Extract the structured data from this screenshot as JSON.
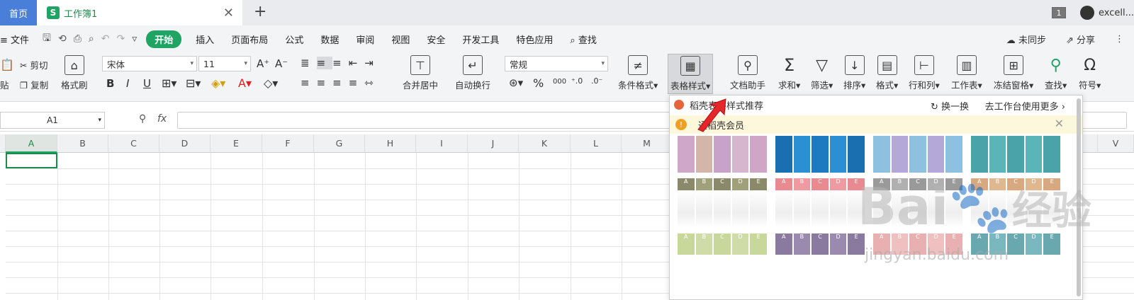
{
  "titlebar": {
    "home_tab": "首页",
    "workbook_tab": "工作簿1",
    "workbook_icon_letter": "S",
    "window_count": "1",
    "user_name": "excell..."
  },
  "menubar": {
    "file": "文件",
    "items": [
      "开始",
      "插入",
      "页面布局",
      "公式",
      "数据",
      "审阅",
      "视图",
      "安全",
      "开发工具",
      "特色应用"
    ],
    "search": "查找",
    "sync": "未同步",
    "share": "分享"
  },
  "ribbon": {
    "paste_fragment": "贴",
    "cut": "剪切",
    "copy": "复制",
    "format_painter": "格式刷",
    "font_name": "宋体",
    "font_size": "11",
    "number_format": "常规",
    "merge_center": "合并居中",
    "wrap_text": "自动换行",
    "percent": "%",
    "thousands": "000",
    "cond_format": "条件格式",
    "table_style": "表格样式",
    "doc_assistant": "文档助手",
    "sum": "求和",
    "filter": "筛选",
    "sort": "排序",
    "format": "格式",
    "rowcol": "行和列",
    "worksheet": "工作表",
    "freeze": "冻结窗格",
    "find": "查找",
    "symbol": "符号"
  },
  "formula_bar": {
    "cell_ref": "A1",
    "fx_label": "fx"
  },
  "grid": {
    "columns": [
      "A",
      "B",
      "C",
      "D",
      "E",
      "F",
      "G",
      "H",
      "I",
      "J",
      "K",
      "L",
      "M",
      "V"
    ]
  },
  "dropdown": {
    "header": "稻壳表格样式推荐",
    "refresh": "换一换",
    "workbench_more": "去工作台使用更多",
    "vip_notice": "通稻壳会员",
    "thumbnails": [
      {
        "colors": [
          "#cfa8c9",
          "#d3b6a9",
          "#c8a2c8",
          "#d6b5ce",
          "#cfa6c6"
        ]
      },
      {
        "colors": [
          "#1a6fb0",
          "#2b8fd3",
          "#1d7ac0",
          "#2b8fd3",
          "#1a6fb0"
        ]
      },
      {
        "colors": [
          "#8ec0e0",
          "#b4a8d8",
          "#8ec0e0",
          "#b4a8d8",
          "#8ec0e0"
        ]
      },
      {
        "colors": [
          "#4aa3a8",
          "#5ab5b8",
          "#4aa3a8",
          "#5ab5b8",
          "#4aa3a8"
        ]
      },
      {
        "colors": [
          "#8a8a6a",
          "#a0a07a",
          "#8a8a6a",
          "#a0a07a",
          "#8a8a6a"
        ]
      },
      {
        "colors": [
          "#e88a90",
          "#ee9aa0",
          "#e88a90",
          "#ee9aa0",
          "#e88a90"
        ]
      },
      {
        "colors": [
          "#9a9a9a",
          "#b0b0b0",
          "#9a9a9a",
          "#b0b0b0",
          "#9a9a9a"
        ]
      },
      {
        "colors": [
          "#d8a880",
          "#e0b890",
          "#d8a880",
          "#e0b890",
          "#d8a880"
        ]
      },
      {
        "colors": [
          "#c8d89a",
          "#d0dca8",
          "#c8d89a",
          "#d0dca8",
          "#c8d89a"
        ]
      },
      {
        "colors": [
          "#8a7aa0",
          "#9a8ab0",
          "#8a7aa0",
          "#9a8ab0",
          "#8a7aa0"
        ]
      },
      {
        "colors": [
          "#e8b0b0",
          "#f0c0c0",
          "#e8b0b0",
          "#f0c0c0",
          "#e8b0b0"
        ]
      },
      {
        "colors": [
          "#6aa8b0",
          "#7ab8c0",
          "#6aa8b0",
          "#7ab8c0",
          "#6aa8b0"
        ]
      }
    ],
    "thumb_col_letters": [
      "A",
      "B",
      "C",
      "D",
      "E"
    ]
  },
  "watermark": {
    "logo_text": "Bai",
    "logo_cn": "经验",
    "url": "jingyan.baidu.com"
  },
  "colors": {
    "accent_green": "#1fa463",
    "arrow_red": "#e5262a"
  }
}
